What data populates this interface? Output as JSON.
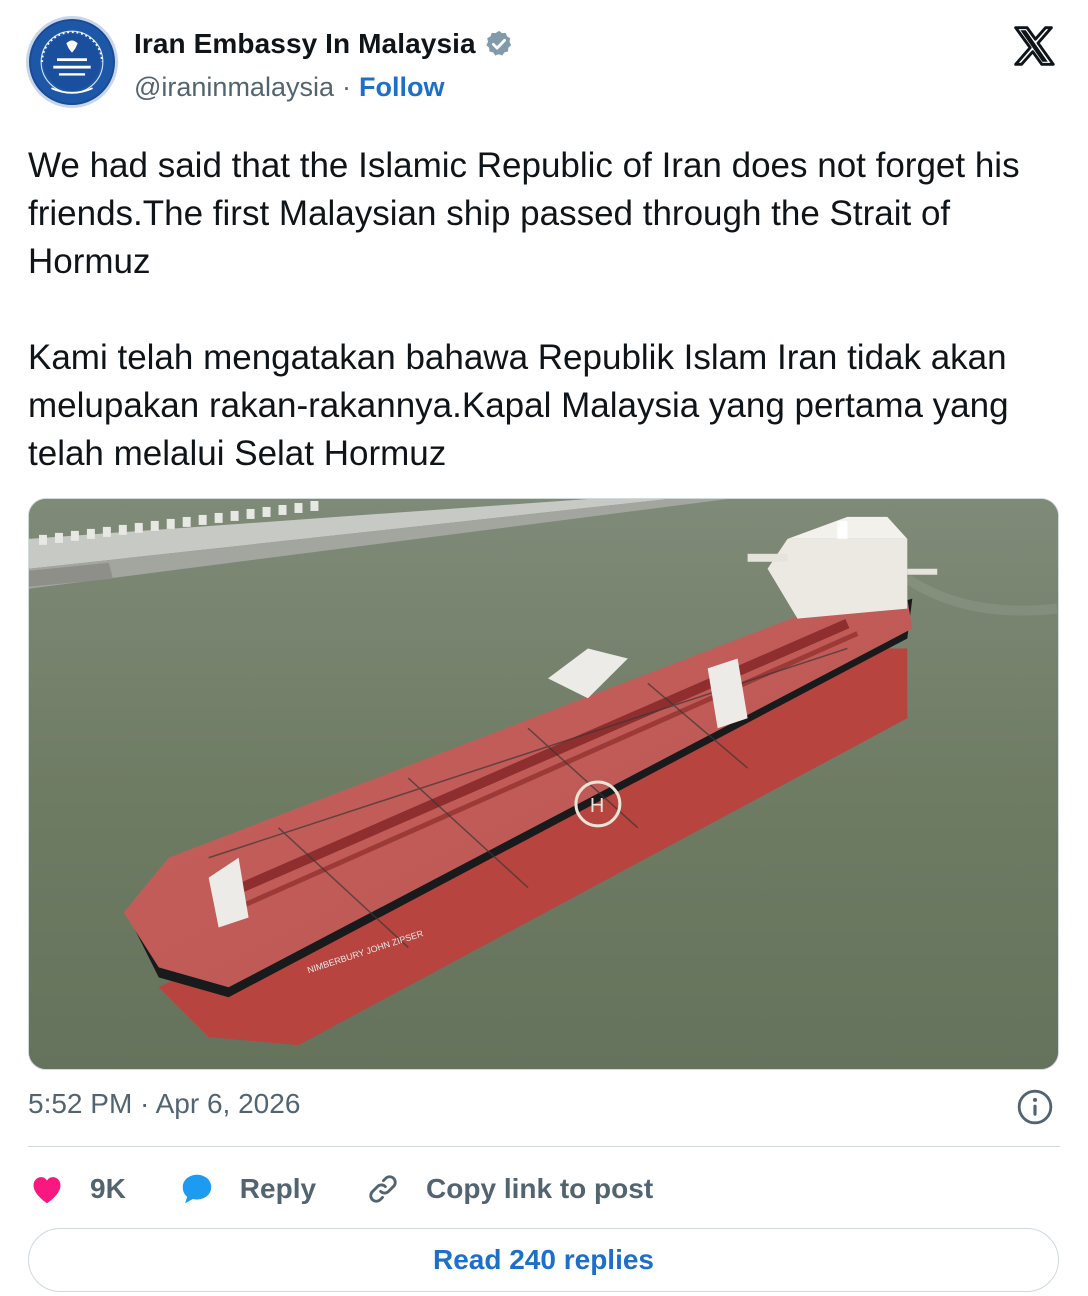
{
  "author": {
    "name": "Iran Embassy In Malaysia",
    "handle": "@iraninmalaysia",
    "separator": "·",
    "follow_label": "Follow"
  },
  "tweet": {
    "paragraph_en": "We had said that the Islamic Republic of Iran does not forget his friends.The first Malaysian ship passed through the Strait of Hormuz",
    "paragraph_ms": "Kami telah mengatakan bahawa Republik Islam Iran tidak akan melupakan rakan-rakannya.Kapal Malaysia yang pertama yang telah melalui Selat Hormuz",
    "timestamp": "5:52 PM · Apr 6, 2026"
  },
  "actions": {
    "like_count": "9K",
    "reply_label": "Reply",
    "copy_link_label": "Copy link to post"
  },
  "read_replies_label": "Read 240 replies",
  "icons": [
    "verified-badge-icon",
    "x-logo-icon",
    "info-icon",
    "heart-icon",
    "reply-bubble-icon",
    "link-icon"
  ],
  "colors": {
    "accent": "#1d6fc9",
    "like": "#f91880",
    "muted": "#536471"
  }
}
